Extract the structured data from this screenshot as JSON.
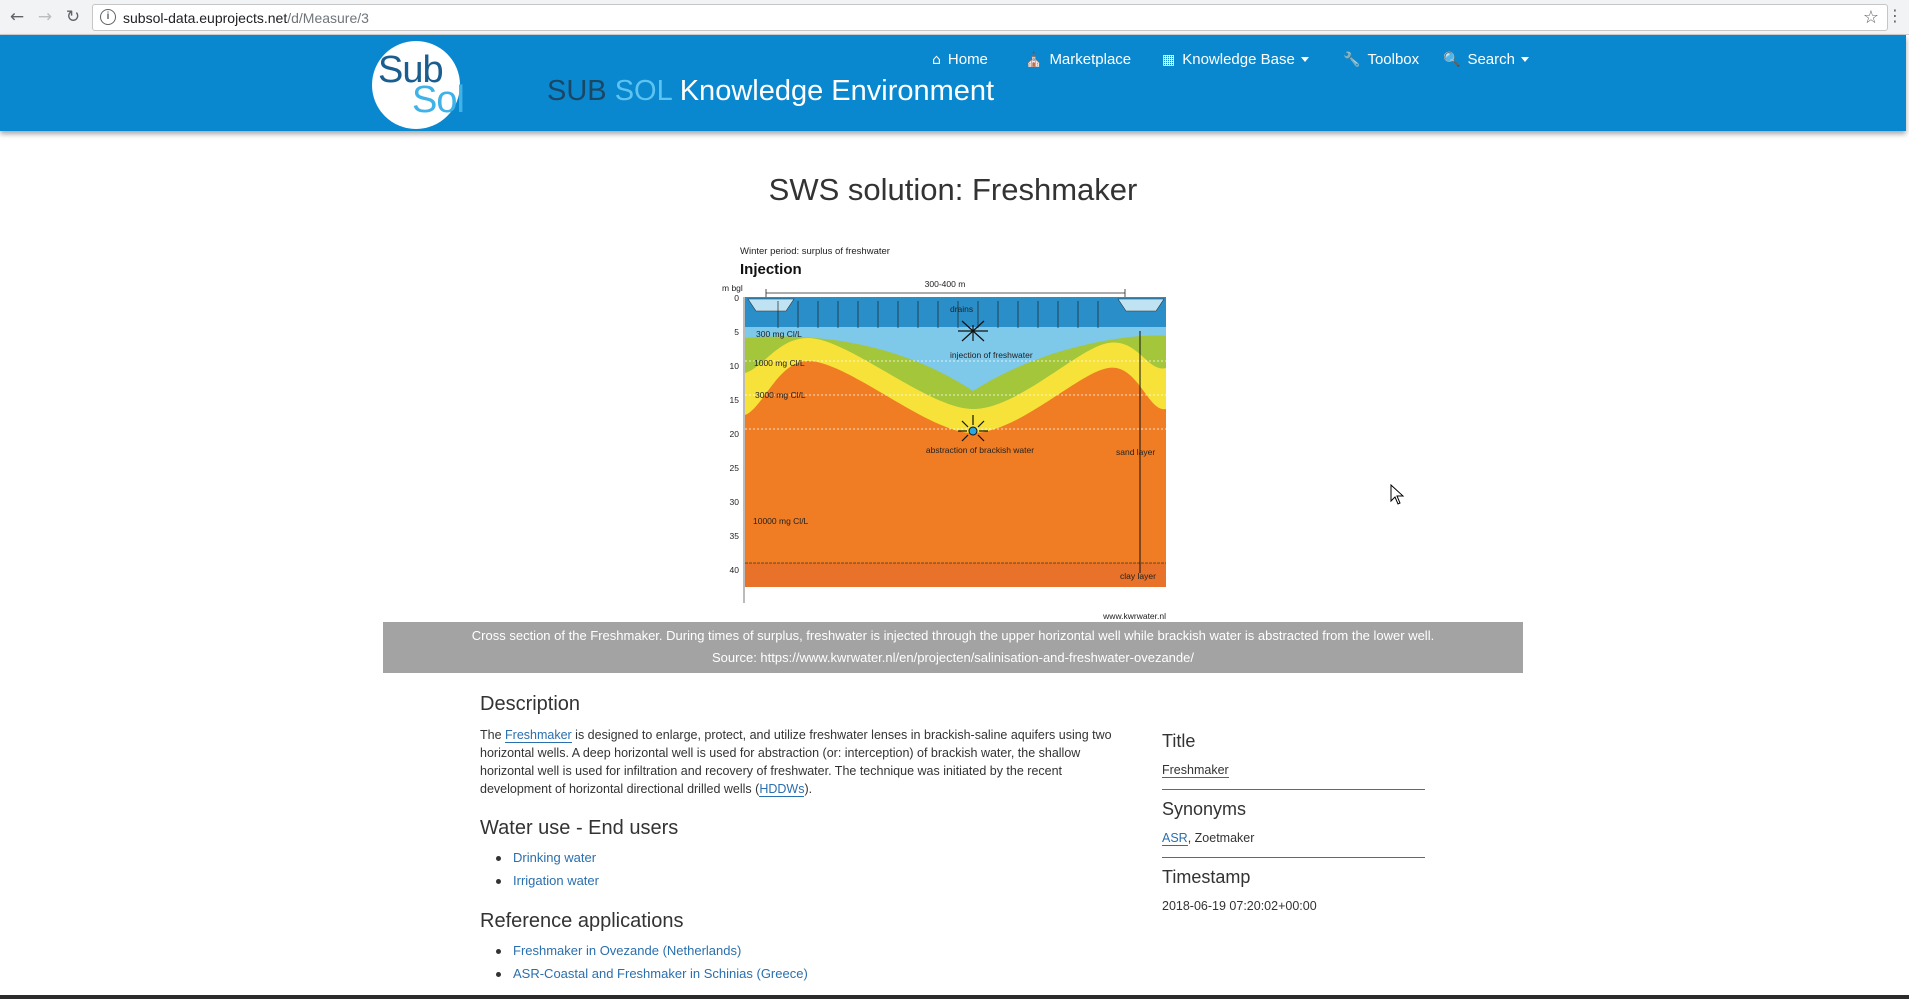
{
  "browser": {
    "url_host": "subsol-data.euprojects.net",
    "url_path": "/d/Measure/3",
    "back_icon": "arrow-left",
    "forward_icon": "arrow-right",
    "reload_icon": "reload",
    "star_icon": "star-outline"
  },
  "navbar": {
    "bg_color": "#0a88cf",
    "logo_sub": "Sub",
    "logo_sol": "Sol",
    "title_part1": "SUB",
    "title_part2": "SOL",
    "title_part3": "Knowledge Environment",
    "items": [
      {
        "label": "Home",
        "icon": "home-icon"
      },
      {
        "label": "Marketplace",
        "icon": "bank-icon"
      },
      {
        "label": "Knowledge Base",
        "icon": "table-icon",
        "dropdown": true
      },
      {
        "label": "Toolbox",
        "icon": "wrench-icon"
      },
      {
        "label": "Search",
        "icon": "search-icon",
        "dropdown": true
      }
    ]
  },
  "page": {
    "title": "SWS solution: Freshmaker"
  },
  "figure": {
    "header_small": "Winter period: surplus of freshwater",
    "header_big": "Injection",
    "axis_unit": "m bgl",
    "depth_ticks": [
      "0",
      "5",
      "10",
      "15",
      "20",
      "25",
      "30",
      "35",
      "40"
    ],
    "width_label": "300-400 m",
    "labels": {
      "drains": "drains",
      "injection": "injection of freshwater",
      "abstraction": "abstraction of brackish water",
      "sand": "sand layer",
      "clay": "clay layer",
      "c300": "300 mg Cl/L",
      "c1000": "1000 mg Cl/L",
      "c3000": "3000 mg Cl/L",
      "c10000": "10000 mg Cl/L",
      "credit": "www.kwrwater.nl"
    }
  },
  "caption": {
    "line1": "Cross section of the Freshmaker. During times of surplus, freshwater is injected through the upper horizontal well while brackish water is abstracted from the lower well.",
    "line2": "Source: https://www.kwrwater.nl/en/projecten/salinisation-and-freshwater-ovezande/"
  },
  "description": {
    "heading": "Description",
    "text_before": "The ",
    "link1": "Freshmaker",
    "text_middle": " is designed to enlarge, protect, and utilize freshwater lenses in brackish-saline aquifers using two horizontal wells. A deep horizontal well is used for abstraction (or: interception) of brackish water, the shallow horizontal well is used for infiltration and recovery of freshwater. The technique was initiated by the recent development of horizontal directional drilled wells (",
    "link2": "HDDWs",
    "text_after": ")."
  },
  "water_use": {
    "heading": "Water use - End users",
    "items": [
      "Drinking water",
      "Irrigation water"
    ]
  },
  "reference": {
    "heading": "Reference applications",
    "items": [
      "Freshmaker in Ovezande (Netherlands)",
      "ASR-Coastal and Freshmaker in Schinias (Greece)"
    ]
  },
  "sidebar": {
    "title_heading": "Title",
    "title_value": "Freshmaker",
    "synonyms_heading": "Synonyms",
    "synonym_link": "ASR",
    "synonym_rest": ", Zoetmaker",
    "timestamp_heading": "Timestamp",
    "timestamp_value": "2018-06-19 07:20:02+00:00"
  }
}
